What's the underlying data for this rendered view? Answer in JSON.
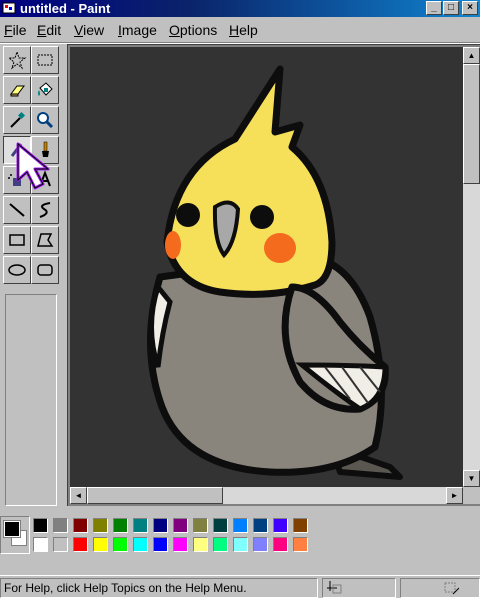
{
  "window": {
    "title": "untitled - Paint",
    "controls": {
      "minimize": "_",
      "maximize": "□",
      "close": "×"
    }
  },
  "menu": [
    {
      "key": "F",
      "rest": "ile"
    },
    {
      "key": "E",
      "rest": "dit"
    },
    {
      "key": "V",
      "rest": "iew"
    },
    {
      "key": "I",
      "rest": "mage"
    },
    {
      "key": "O",
      "rest": "ptions"
    },
    {
      "key": "H",
      "rest": "elp"
    }
  ],
  "tools": [
    {
      "name": "free-form-select-tool-button",
      "icon": "star-select-icon",
      "active": false
    },
    {
      "name": "rect-select-tool-button",
      "icon": "rect-select-icon",
      "active": false
    },
    {
      "name": "eraser-tool-button",
      "icon": "eraser-icon",
      "active": false
    },
    {
      "name": "fill-tool-button",
      "icon": "paint-bucket-icon",
      "active": false
    },
    {
      "name": "color-picker-tool-button",
      "icon": "eyedropper-icon",
      "active": false
    },
    {
      "name": "magnifier-tool-button",
      "icon": "magnifier-icon",
      "active": false
    },
    {
      "name": "pencil-tool-button",
      "icon": "pencil-icon",
      "active": true
    },
    {
      "name": "brush-tool-button",
      "icon": "brush-icon",
      "active": false
    },
    {
      "name": "airbrush-tool-button",
      "icon": "airbrush-icon",
      "active": false
    },
    {
      "name": "text-tool-button",
      "icon": "text-icon",
      "active": false
    },
    {
      "name": "line-tool-button",
      "icon": "line-icon",
      "active": false
    },
    {
      "name": "curve-tool-button",
      "icon": "curve-icon",
      "active": false
    },
    {
      "name": "rectangle-tool-button",
      "icon": "rectangle-icon",
      "active": false
    },
    {
      "name": "polygon-tool-button",
      "icon": "polygon-icon",
      "active": false
    },
    {
      "name": "ellipse-tool-button",
      "icon": "ellipse-icon",
      "active": false
    },
    {
      "name": "rounded-rect-tool-button",
      "icon": "rounded-rectangle-icon",
      "active": false
    }
  ],
  "palette": {
    "foreground": "#000000",
    "background": "#ffffff",
    "top_row": [
      "#000000",
      "#808080",
      "#800000",
      "#808000",
      "#008000",
      "#008080",
      "#000080",
      "#800080",
      "#808040",
      "#004040",
      "#0080ff",
      "#004080",
      "#4000ff",
      "#804000"
    ],
    "bottom_row": [
      "#ffffff",
      "#c0c0c0",
      "#ff0000",
      "#ffff00",
      "#00ff00",
      "#00ffff",
      "#0000ff",
      "#ff00ff",
      "#ffff80",
      "#00ff80",
      "#80ffff",
      "#8080ff",
      "#ff0080",
      "#ff8040"
    ]
  },
  "drawing": {
    "subject": "cockatiel",
    "colors": {
      "canvas": "#333333",
      "outline": "#0d0d0d",
      "head": "#f6e05a",
      "cheek": "#f46b1e",
      "body": "#8a857c",
      "wing": "#f0eee6",
      "beak": "#a8a8a8",
      "cursor_outline": "#a020f0"
    }
  },
  "statusbar": {
    "message": "For Help, click Help Topics on the Help Menu."
  }
}
